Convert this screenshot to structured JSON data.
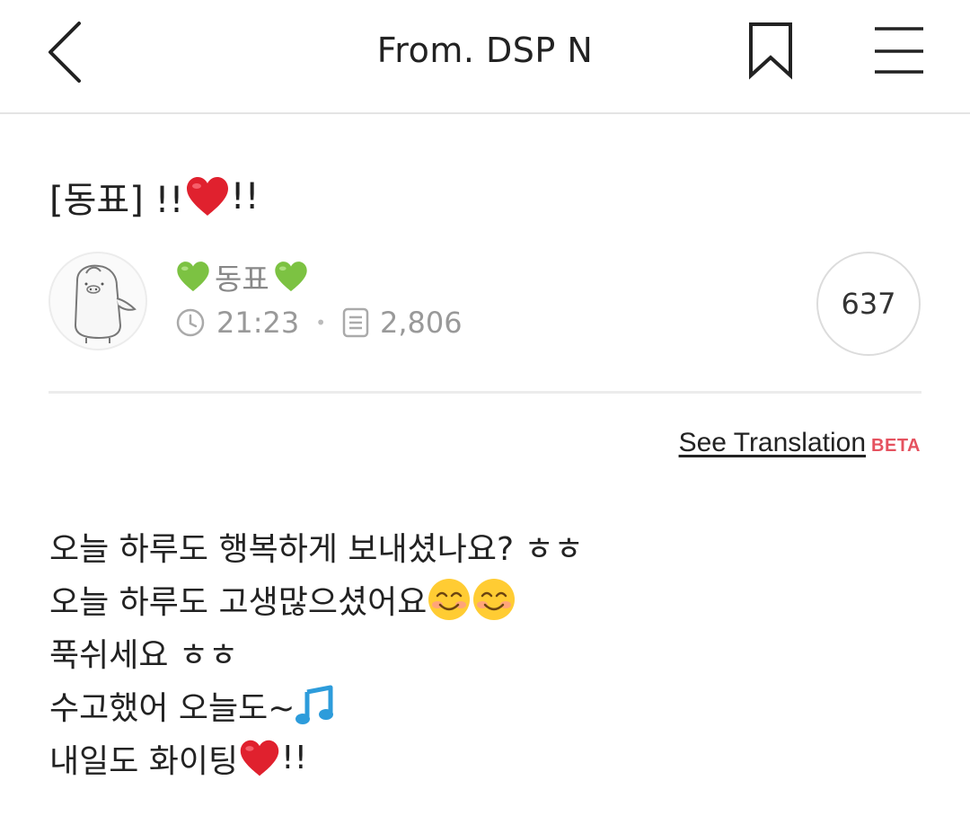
{
  "header": {
    "title": "From. DSP N"
  },
  "post": {
    "title_prefix": "[동표] !!",
    "title_suffix": "!!",
    "author_name": "동표",
    "time": "21:23",
    "views": "2,806",
    "comment_count": "637"
  },
  "translation": {
    "link_label": "See Translation",
    "badge": "BETA"
  },
  "body_lines": {
    "l1": "오늘 하루도 행복하게 보내셨나요? ㅎㅎ",
    "l2": "오늘 하루도 고생많으셨어요",
    "l3": "푹쉬세요 ㅎㅎ",
    "l4": "수고했어 오늘도~",
    "l5_text": "내일도 화이팅",
    "l5_end": "!!"
  },
  "colors": {
    "accent_beta": "#e5525f",
    "heart_red": "#e0212e",
    "heart_green": "#7cc242",
    "music_note": "#2d9cdb"
  },
  "icons": {
    "back": "chevron-left-icon",
    "bookmark": "bookmark-icon",
    "menu": "hamburger-menu-icon",
    "clock": "clock-icon",
    "views": "document-icon"
  }
}
